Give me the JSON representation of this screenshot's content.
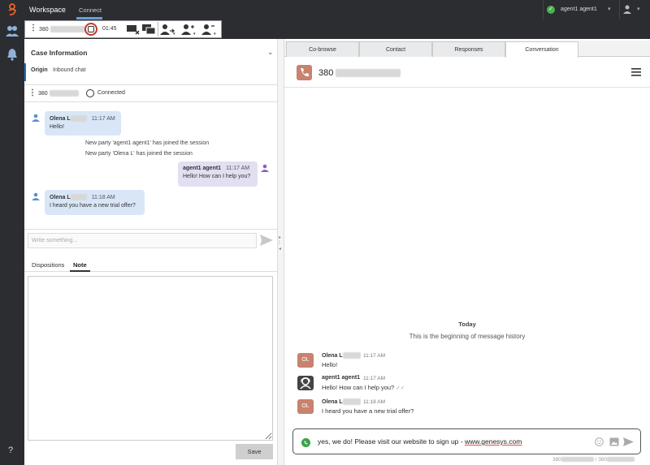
{
  "topbar": {
    "workspace_label": "Workspace",
    "connect_label": "Connect",
    "agent_name": "agent1 agent1"
  },
  "toolbar": {
    "interaction_number": "380",
    "timer": "01:45"
  },
  "case": {
    "title": "Case Information",
    "origin_label": "Origin",
    "origin_value": "Inbound chat"
  },
  "party": {
    "number": "380",
    "status": "Connected"
  },
  "transcript": {
    "messages": [
      {
        "name": "Olena L",
        "time": "11:17 AM",
        "text": "Hello!"
      },
      {
        "name": "agent1 agent1",
        "time": "11:17 AM",
        "text": "Hello! How can I help you?"
      },
      {
        "name": "Olena L",
        "time": "11:18 AM",
        "text": "I heard you have a new trial offer?"
      }
    ],
    "system": [
      "New party 'agent1 agent1' has joined the session",
      "New party 'Olena L' has joined the session"
    ]
  },
  "compose": {
    "placeholder": "Write something..."
  },
  "notes": {
    "tabs": [
      "Dispositions",
      "Note"
    ],
    "save_label": "Save"
  },
  "right": {
    "tabs": [
      "Co-browse",
      "Contact",
      "Responses",
      "Conversation"
    ],
    "header_number": "380",
    "today_label": "Today",
    "history_start": "This is the beginning of message history",
    "messages": [
      {
        "initials": "OL",
        "name": "Olena L",
        "time": "11:17 AM",
        "text": "Hello!"
      },
      {
        "initials": "",
        "name": "agent1 agent1",
        "time": "11:17 AM",
        "text": "Hello! How can I help you?"
      },
      {
        "initials": "OL",
        "name": "Olena L",
        "time": "11:18 AM",
        "text": "I heard you have a new trial offer?"
      }
    ],
    "reply_text": "yes, we do! Please visit our website to sign up - ",
    "reply_link": "www.genesys.com",
    "footer_left": "380",
    "footer_right": "/ 380"
  },
  "colors": {
    "topbar_bg": "#2b2d30",
    "customer_bubble": "#d8e6f7",
    "agent_bubble": "#e2dff2",
    "customer_avatar": "#c8826e",
    "whatsapp_green": "#3da34b",
    "status_green": "#4caf50",
    "record_red": "#c0392b"
  }
}
